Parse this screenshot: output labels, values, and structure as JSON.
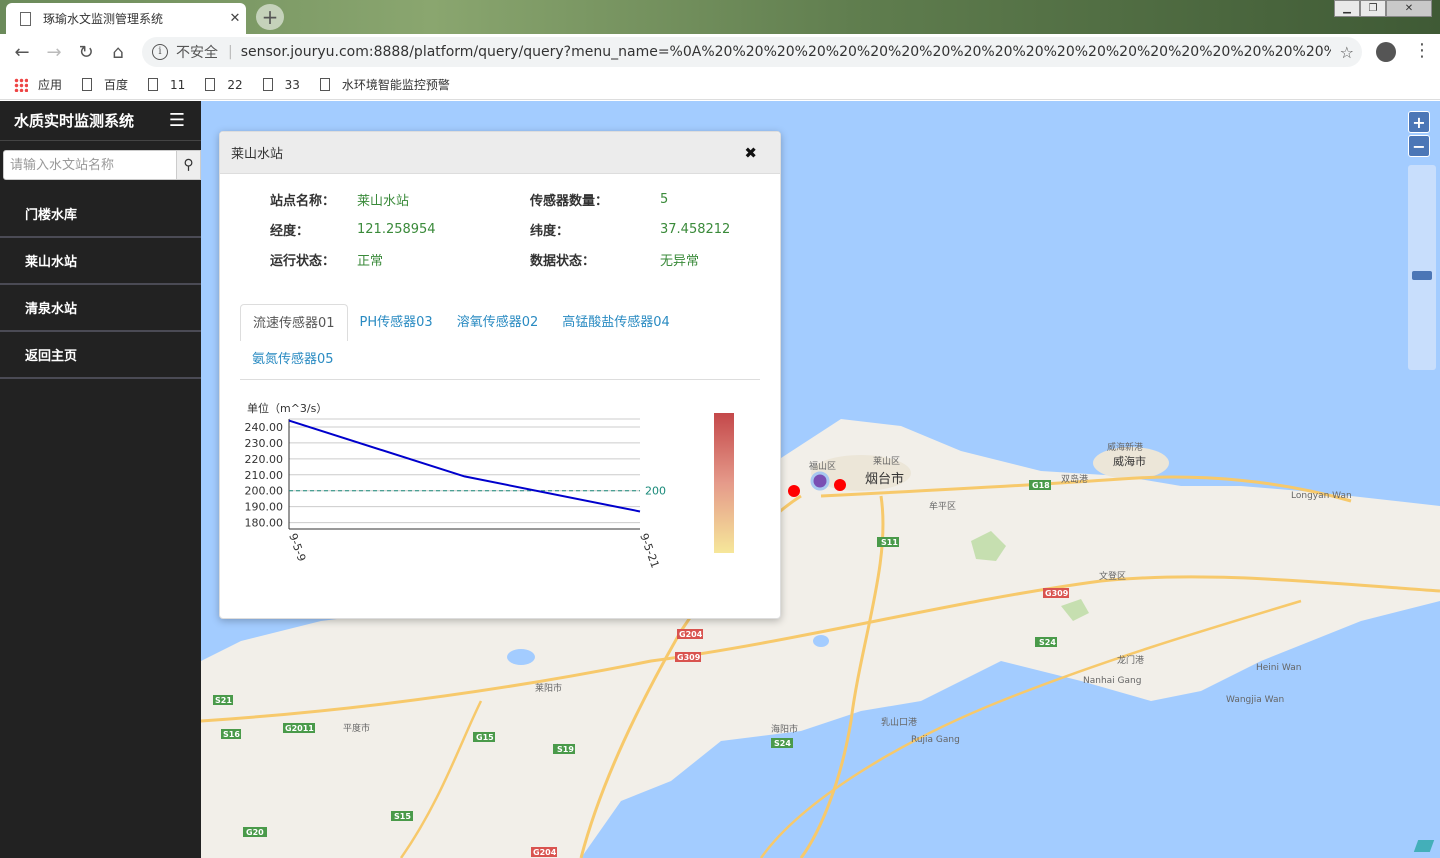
{
  "browser": {
    "tab_title": "琢瑜水文监测管理系统",
    "tab_close": "✕",
    "new_tab": "+",
    "nav": {
      "back": "←",
      "forward": "→",
      "reload": "↻",
      "home": "⌂"
    },
    "security_label": "不安全",
    "url": "sensor.jouryu.com:8888/platform/query/query?menu_name=%0A%20%20%20%20%20%20%20%20%20%20%20%20%20%20%20%20%20%20%20%20%20%20%20...",
    "window_buttons": {
      "minimize": "▁",
      "maximize": "❐",
      "close": "✕"
    },
    "bookmarks": [
      {
        "label": "应用",
        "icon": "apps-grid-icon"
      },
      {
        "label": "百度",
        "icon": "page-icon"
      },
      {
        "label": "11",
        "icon": "page-icon"
      },
      {
        "label": "22",
        "icon": "page-icon"
      },
      {
        "label": "33",
        "icon": "page-icon"
      },
      {
        "label": "水环境智能监控预警",
        "icon": "page-icon"
      }
    ]
  },
  "sidebar": {
    "title": "水质实时监测系统",
    "search_placeholder": "请输入水文站名称",
    "items": [
      {
        "label": "门楼水库"
      },
      {
        "label": "莱山水站"
      },
      {
        "label": "清泉水站"
      },
      {
        "label": "返回主页"
      }
    ]
  },
  "map": {
    "zoom_in": "+",
    "zoom_out": "−",
    "colors": {
      "sea": "#a3ccff",
      "land": "#f2efe9",
      "station_marker": "#ff0000",
      "selected_marker": "#7a4fb3"
    },
    "labels": [
      {
        "text": "烟台市"
      },
      {
        "text": "威海市"
      },
      {
        "text": "莱山区"
      },
      {
        "text": "福山区"
      },
      {
        "text": "牟平区"
      },
      {
        "text": "文登区"
      },
      {
        "text": "乳山口港"
      },
      {
        "text": "Rujia Gang"
      },
      {
        "text": "Longyan Wan"
      },
      {
        "text": "Heini Wan"
      },
      {
        "text": "Nanhai Gang"
      },
      {
        "text": "Wangjia Wan"
      },
      {
        "text": "双岛港"
      },
      {
        "text": "威海新港"
      },
      {
        "text": "龙门港"
      },
      {
        "text": "海阳市"
      },
      {
        "text": "莱阳市"
      },
      {
        "text": "平度市"
      }
    ],
    "road_badges": [
      "G18",
      "S11",
      "G309",
      "G204",
      "S24",
      "S19",
      "G15",
      "G2011",
      "S21",
      "S16",
      "S15",
      "G20",
      "S24",
      "G309",
      "G204"
    ]
  },
  "popup": {
    "title": "莱山水站",
    "close_icon": "✖",
    "fields": {
      "site_name_label": "站点名称：",
      "site_name": "莱山水站",
      "sensor_count_label": "传感器数量：",
      "sensor_count": "5",
      "longitude_label": "经度：",
      "longitude": "121.258954",
      "latitude_label": "纬度：",
      "latitude": "37.458212",
      "run_status_label": "运行状态：",
      "run_status": "正常",
      "data_status_label": "数据状态：",
      "data_status": "无异常"
    },
    "tabs": [
      {
        "label": "流速传感器01",
        "active": true
      },
      {
        "label": "PH传感器03",
        "active": false
      },
      {
        "label": "溶氧传感器02",
        "active": false
      },
      {
        "label": "高锰酸盐传感器04",
        "active": false
      },
      {
        "label": "氨氮传感器05",
        "active": false
      }
    ]
  },
  "chart_data": {
    "type": "line",
    "ylabel": "单位（m^3/s）",
    "x": [
      "9-5-9",
      "9-5-15",
      "9-5-21"
    ],
    "x_tick_labels": [
      "9-5-9",
      "9-5-21"
    ],
    "series": [
      {
        "values": [
          244,
          209,
          187
        ],
        "color": "#0000cc"
      }
    ],
    "yticks": [
      180.0,
      190.0,
      200.0,
      210.0,
      220.0,
      230.0,
      240.0
    ],
    "ytick_labels": [
      "180.00",
      "190.00",
      "200.00",
      "210.00",
      "220.00",
      "230.00",
      "240.00"
    ],
    "ylim": [
      176,
      245
    ],
    "threshold": {
      "value": 200,
      "label": "200",
      "color": "#1a8a7a"
    },
    "grid": true
  }
}
